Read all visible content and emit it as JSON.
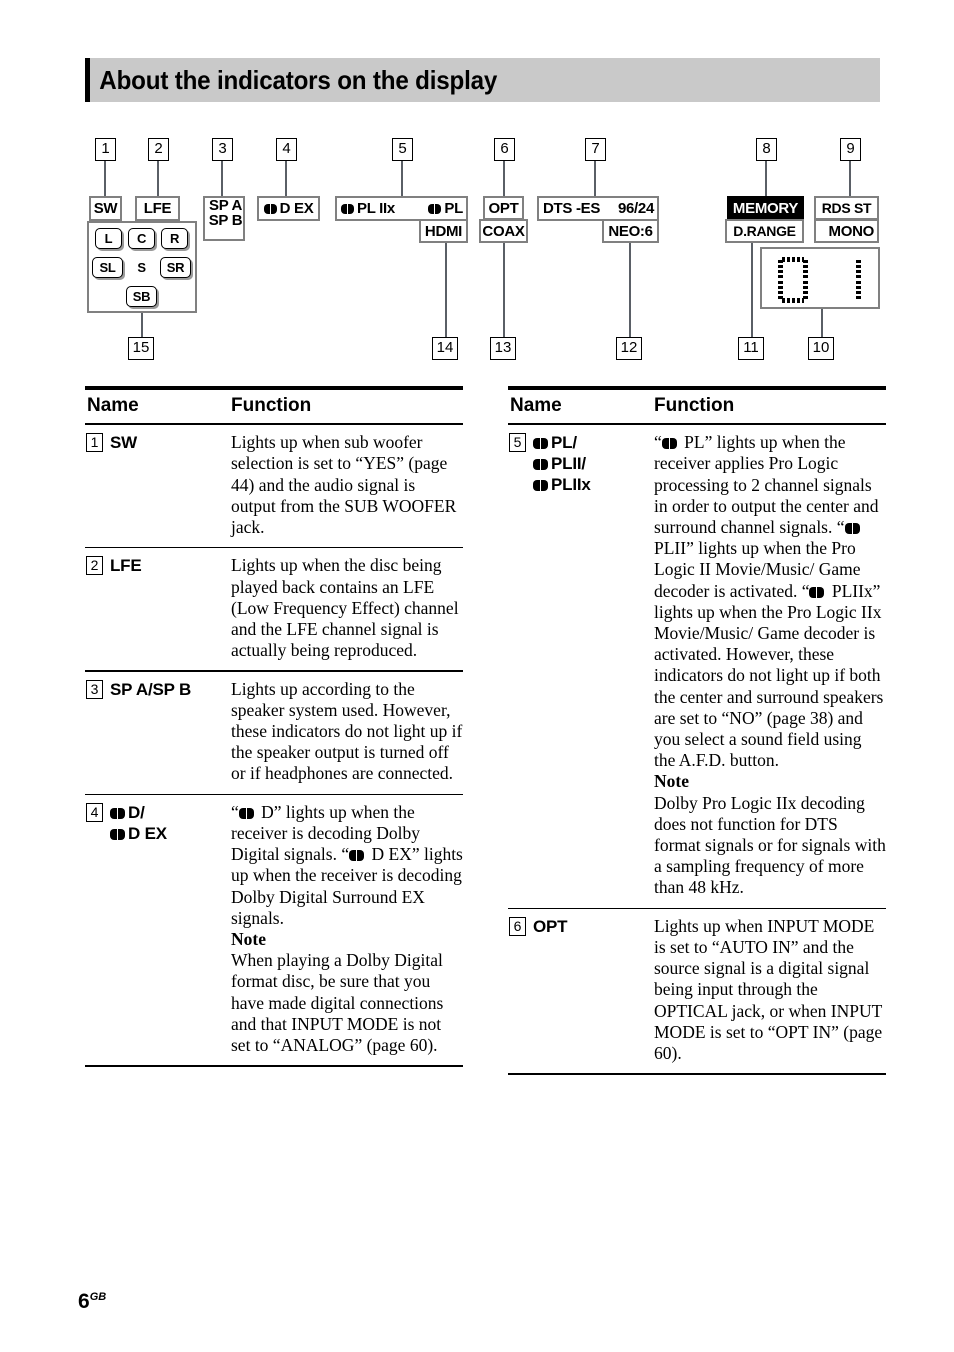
{
  "header": {
    "title": "About the indicators on the display"
  },
  "footer": {
    "page": "6",
    "region": "GB"
  },
  "diagram": {
    "callouts_top": [
      "1",
      "2",
      "3",
      "4",
      "5",
      "6",
      "7",
      "8",
      "9"
    ],
    "callouts_bottom": [
      "15",
      "14",
      "13",
      "12",
      "11",
      "10"
    ],
    "indicators": {
      "sw": "SW",
      "lfe": "LFE",
      "sp_a": "SP A",
      "sp_b": "SP B",
      "d_ex": "D EX",
      "pl_iix": "PL IIx",
      "pl": "PL",
      "hdmi": "HDMI",
      "opt": "OPT",
      "coax": "COAX",
      "dts_es": "DTS -ES",
      "bits": "96/24",
      "neo6": "NEO:6",
      "memory": "MEMORY",
      "drange": "D.RANGE",
      "rds_st": "RDS ST",
      "mono": "MONO"
    },
    "speakers": {
      "l": "L",
      "c": "C",
      "r": "R",
      "sl": "SL",
      "s": "S",
      "sr": "SR",
      "sb": "SB"
    }
  },
  "tables": {
    "headers": {
      "name": "Name",
      "function": "Function"
    },
    "left_rows": [
      {
        "num": "1",
        "name": "SW",
        "function": "Lights up when sub woofer selection is set to “YES” (page 44) and the audio signal is output from the SUB WOOFER jack."
      },
      {
        "num": "2",
        "name": "LFE",
        "function": "Lights up when the disc being played back contains an LFE (Low Frequency Effect) channel and the LFE channel signal is actually being reproduced."
      },
      {
        "num": "3",
        "name": "SP A/SP B",
        "function": "Lights up according to the speaker system used. However, these indicators do not light up if the speaker output is turned off or if headphones are connected."
      },
      {
        "num": "4",
        "name_line1": "D/",
        "name_line2": "D EX",
        "function_a": "“",
        "function_b": " D” lights up when the receiver is decoding Dolby Digital signals. “",
        "function_c": " D EX” lights up when the receiver is decoding Dolby Digital Surround EX signals.",
        "note_label": "Note",
        "note_body": "When playing a Dolby Digital format disc, be sure that you have made digital connections and that INPUT MODE is not set to “ANALOG” (page 60)."
      }
    ],
    "right_rows": [
      {
        "num": "5",
        "name_line1": "PL/",
        "name_line2": "PLII/",
        "name_line3": "PLIIx",
        "function_a": "“",
        "function_b": " PL” lights up when the receiver applies Pro Logic processing to 2 channel signals in order to output the center and surround channel signals. “",
        "function_c": " PLII” lights up when the Pro Logic II Movie/Music/ Game decoder is activated. “",
        "function_d": " PLIIx” lights up when the Pro Logic IIx Movie/Music/ Game decoder is activated. However, these indicators do not light up if both the center and surround speakers are set to “NO” (page 38) and you select a sound field using the A.F.D. button.",
        "note_label": "Note",
        "note_body": "Dolby Pro Logic IIx decoding does not function for DTS format signals or for signals with a sampling frequency of more than 48 kHz."
      },
      {
        "num": "6",
        "name": "OPT",
        "function": "Lights up when INPUT MODE is set to “AUTO IN” and the source signal is a digital signal being input through the OPTICAL jack, or when INPUT MODE is set to “OPT IN” (page 60)."
      }
    ]
  },
  "colors": {
    "header_band": "#c9c9c9",
    "chip_border": "#808080",
    "leader_line": "#5a5f66",
    "text": "#000000"
  }
}
